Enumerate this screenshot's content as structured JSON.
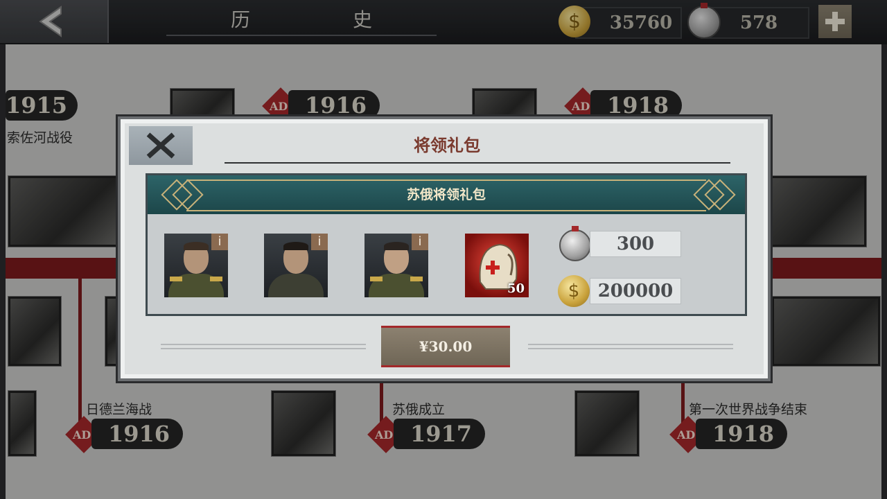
{
  "header": {
    "title": "历　史",
    "gold": "35760",
    "silver": "578"
  },
  "timeline": {
    "top_years": [
      {
        "ad": "",
        "year": "1915"
      },
      {
        "ad": "AD",
        "year": "1916"
      },
      {
        "ad": "AD",
        "year": "1918"
      }
    ],
    "top_events": [
      "索佐河战役"
    ],
    "bottom_events": [
      {
        "name": "日德兰海战",
        "ad": "AD",
        "year": "1916"
      },
      {
        "name": "苏俄成立",
        "ad": "AD",
        "year": "1917"
      },
      {
        "name": "第一次世界战争结束",
        "ad": "AD",
        "year": "1918"
      }
    ]
  },
  "modal": {
    "title": "将领礼包",
    "pack_title": "苏俄将领礼包",
    "info_label": "i",
    "item_quantity": "50",
    "silver_reward": "300",
    "gold_reward": "200000",
    "price": "¥30.00"
  },
  "colors": {
    "accent_red": "#a3282a",
    "pack_header": "#2d6468",
    "title_brown": "#7a3a2e"
  }
}
